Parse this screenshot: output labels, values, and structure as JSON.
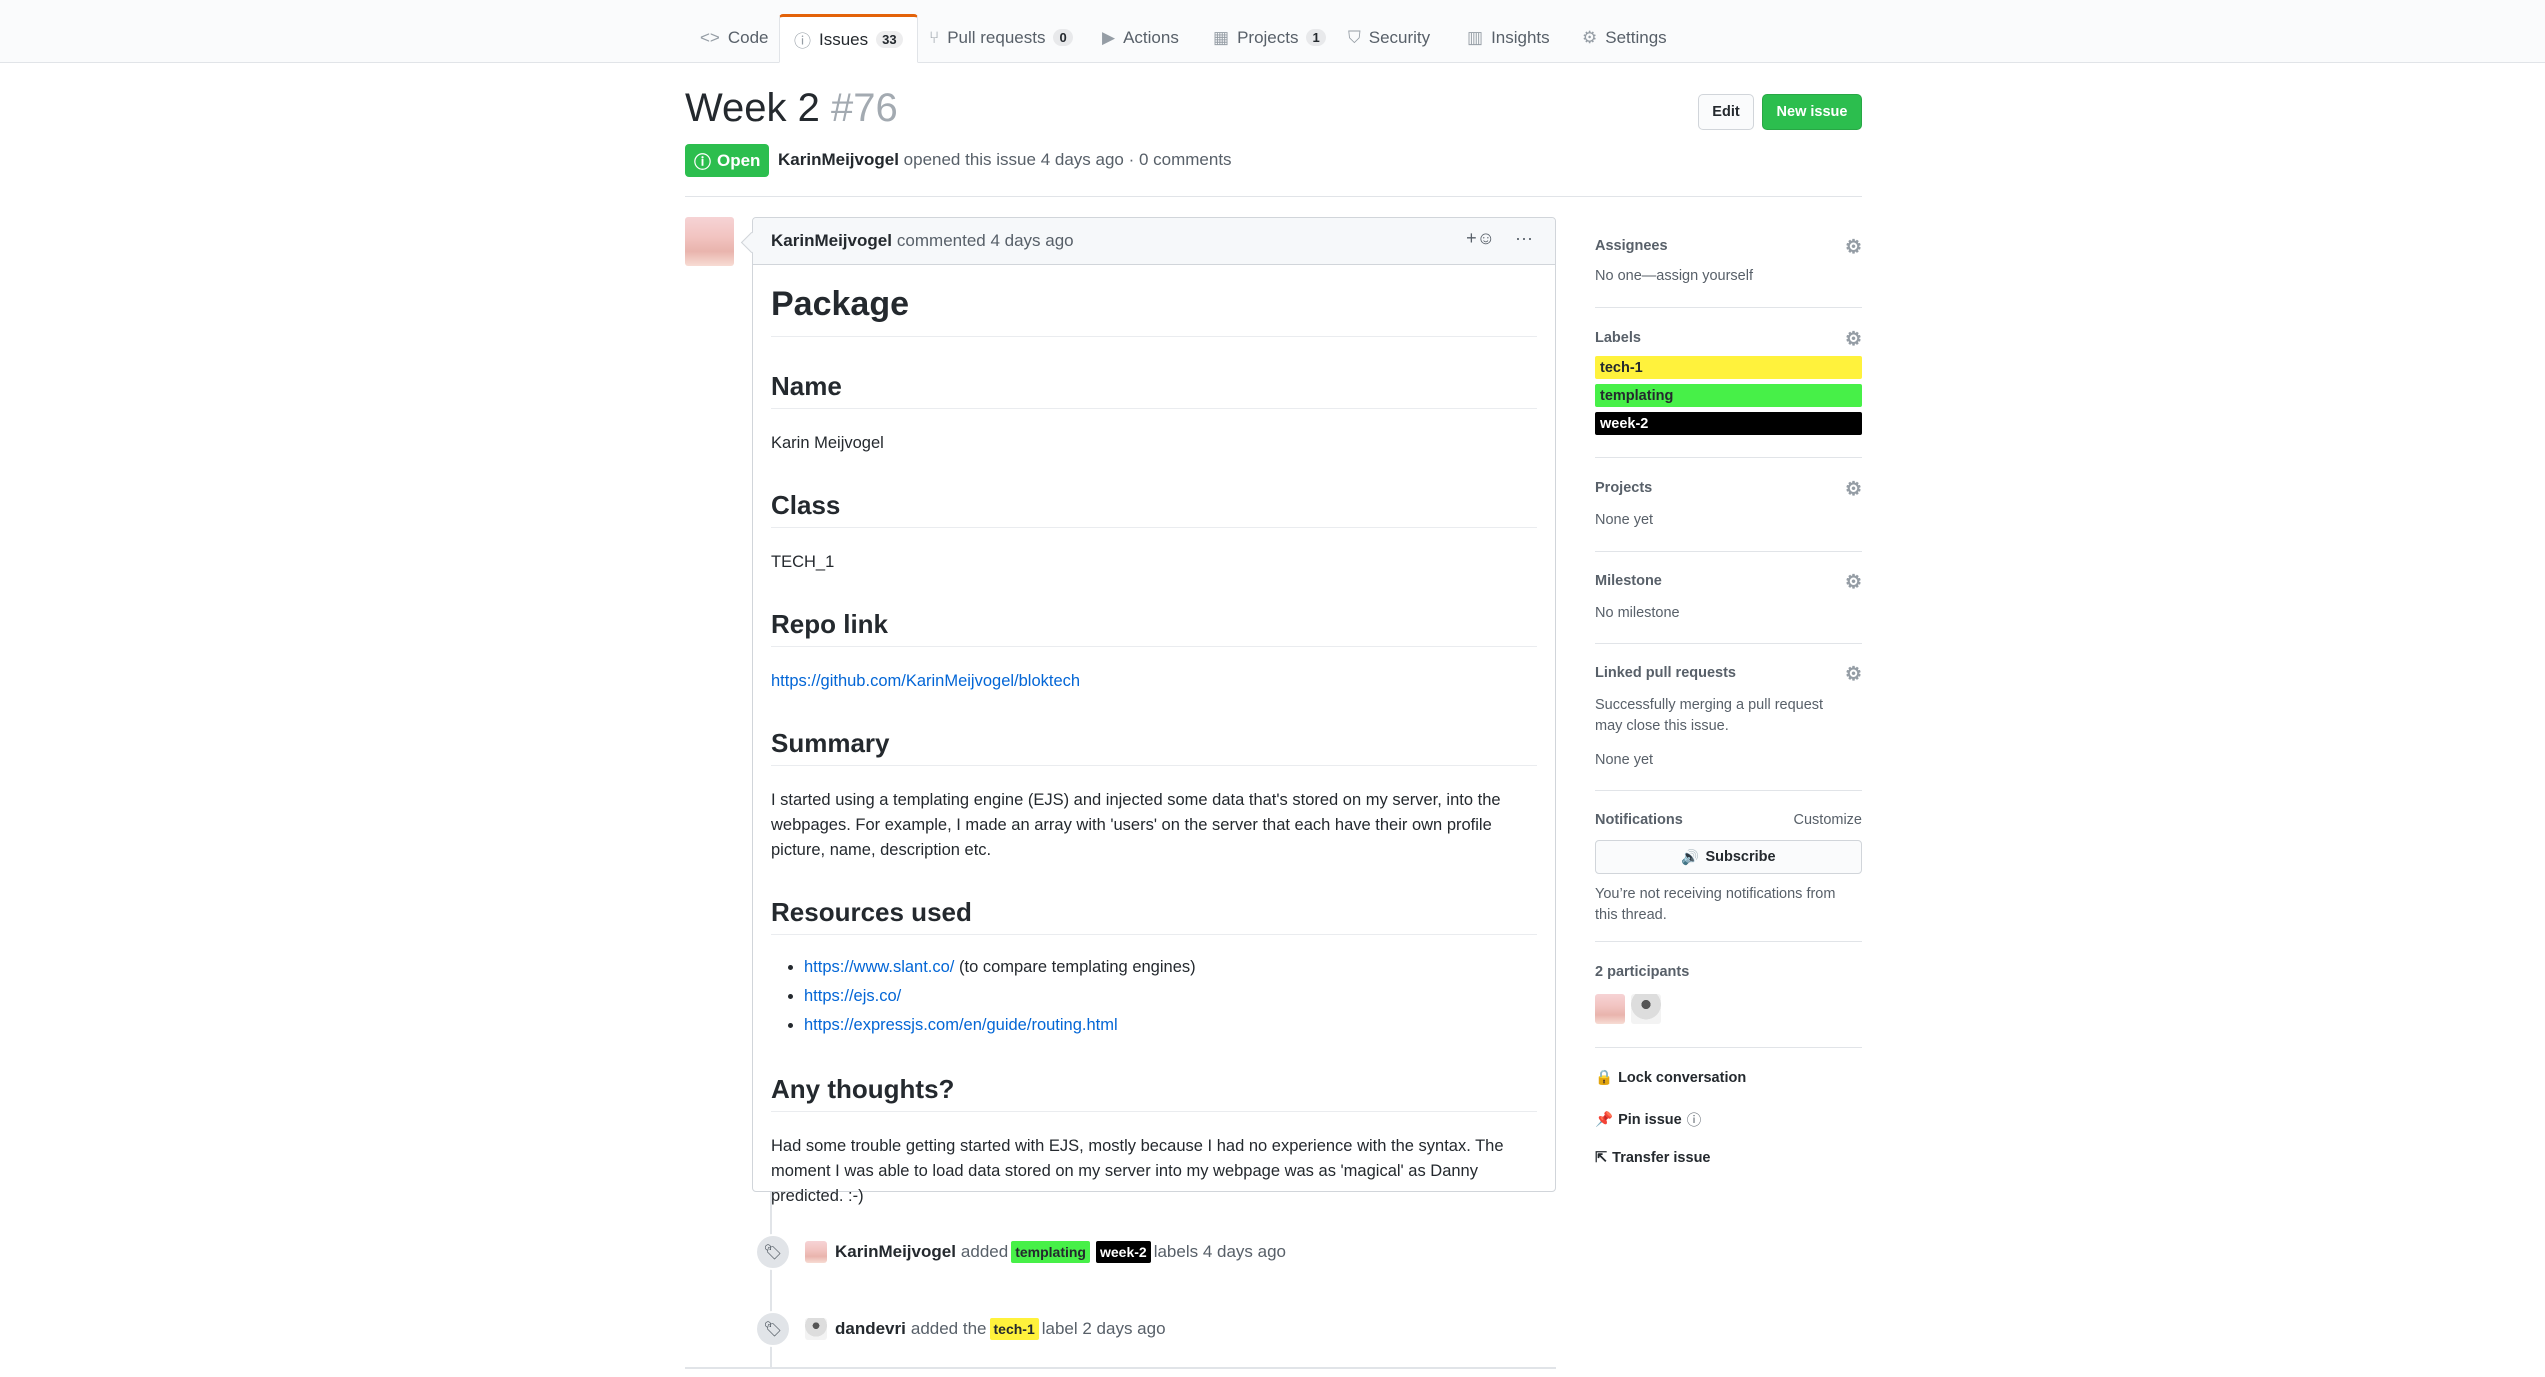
{
  "nav": {
    "tabs": [
      {
        "icon": "<>",
        "label": "Code",
        "count": ""
      },
      {
        "icon": "ⓘ",
        "label": "Issues",
        "count": "33"
      },
      {
        "icon": "⑂",
        "label": "Pull requests",
        "count": "0"
      },
      {
        "icon": "▶",
        "label": "Actions",
        "count": ""
      },
      {
        "icon": "▦",
        "label": "Projects",
        "count": "1"
      },
      {
        "icon": "⛉",
        "label": "Security",
        "count": ""
      },
      {
        "icon": "▥",
        "label": "Insights",
        "count": ""
      },
      {
        "icon": "⚙",
        "label": "Settings",
        "count": ""
      }
    ],
    "selected_color": "#e36209"
  },
  "issue": {
    "title": "Week 2",
    "number": "#76",
    "state": "Open",
    "author": "KarinMeijvogel",
    "meta": "opened this issue 4 days ago · 0 comments",
    "edit_label": "Edit",
    "new_issue_label": "New issue"
  },
  "comment": {
    "author": "KarinMeijvogel",
    "time": "commented 4 days ago",
    "reaction_icon": "+☺",
    "more_icon": "···",
    "h1": "Package",
    "name_heading": "Name",
    "name_value": "Karin Meijvogel",
    "class_heading": "Class",
    "class_value": "TECH_1",
    "repo_heading": "Repo link",
    "repo_link": "https://github.com/KarinMeijvogel/bloktech",
    "summary_heading": "Summary",
    "summary_text": "I started using a templating engine (EJS) and injected some data that's stored on my server, into the webpages. For example, I made an array with 'users' on the server that each have their own profile picture, name, description etc.",
    "resources_heading": "Resources used",
    "resources": [
      {
        "link": "https://www.slant.co/",
        "note": " (to compare templating engines)"
      },
      {
        "link": "https://ejs.co/",
        "note": ""
      },
      {
        "link": "https://expressjs.com/en/guide/routing.html",
        "note": ""
      }
    ],
    "thoughts_heading": "Any thoughts?",
    "thoughts_text": "Had some trouble getting started with EJS, mostly because I had no experience with the syntax. The moment I was able to load data stored on my server into my webpage was as 'magical' as Danny predicted. :-)"
  },
  "timeline": [
    {
      "author": "KarinMeijvogel",
      "action": "added",
      "labels": [
        "templating",
        "week-2"
      ],
      "suffix": "labels 4 days ago"
    },
    {
      "author": "dandevri",
      "action": "added the",
      "labels": [
        "tech-1"
      ],
      "suffix": "label 2 days ago"
    }
  ],
  "sidebar": {
    "assignees": {
      "heading": "Assignees",
      "text": "No one—assign yourself"
    },
    "labels": {
      "heading": "Labels",
      "items": [
        {
          "name": "tech-1",
          "color": "#fff23c",
          "text_color": "#24292e"
        },
        {
          "name": "templating",
          "color": "#47f048",
          "text_color": "#24292e"
        },
        {
          "name": "week-2",
          "color": "#000000",
          "text_color": "#ffffff"
        }
      ]
    },
    "projects": {
      "heading": "Projects",
      "text": "None yet"
    },
    "milestone": {
      "heading": "Milestone",
      "text": "No milestone"
    },
    "linked": {
      "heading": "Linked pull requests",
      "text": "Successfully merging a pull request may close this issue.",
      "text2": "None yet"
    },
    "notifications": {
      "heading": "Notifications",
      "customize": "Customize",
      "button": "Subscribe",
      "text": "You’re not receiving notifications from this thread."
    },
    "participants": {
      "heading": "2 participants"
    },
    "lock": "Lock conversation",
    "pin": "Pin issue",
    "transfer": "Transfer issue"
  }
}
